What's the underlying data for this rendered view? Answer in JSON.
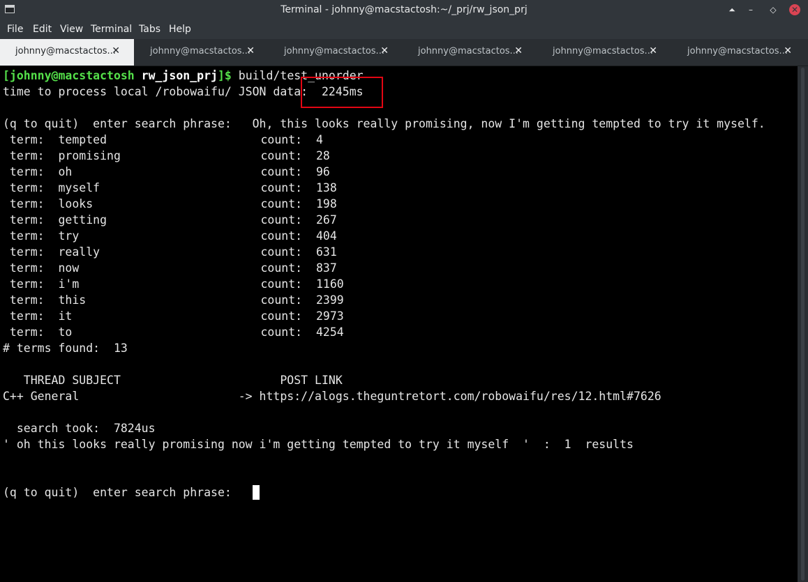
{
  "window": {
    "title": "Terminal - johnny@macstactosh:~/_prj/rw_json_prj"
  },
  "menu": [
    "File",
    "Edit",
    "View",
    "Terminal",
    "Tabs",
    "Help"
  ],
  "tabs": [
    {
      "label": "johnny@macstactos...",
      "close": "✕",
      "active": true
    },
    {
      "label": "johnny@macstactos...",
      "close": "✕",
      "active": false
    },
    {
      "label": "johnny@macstactos...",
      "close": "✕",
      "active": false
    },
    {
      "label": "johnny@macstactos...",
      "close": "✕",
      "active": false
    },
    {
      "label": "johnny@macstactos...",
      "close": "✕",
      "active": false
    },
    {
      "label": "johnny@macstactos...",
      "close": "✕",
      "active": false
    }
  ],
  "terminal": {
    "prompt": {
      "user": "[johnny@macstactosh",
      "dir": " rw_json_prj",
      "symbol": "]$",
      "command": " build/test_unorder"
    },
    "load_line": "time to process local /robowaifu/ JSON data:  2245ms",
    "search_line": "(q to quit)  enter search phrase:   Oh, this looks really promising, now I'm getting tempted to try it myself.",
    "terms": [
      {
        "term": "tempted",
        "count": "4"
      },
      {
        "term": "promising",
        "count": "28"
      },
      {
        "term": "oh",
        "count": "96"
      },
      {
        "term": "myself",
        "count": "138"
      },
      {
        "term": "looks",
        "count": "198"
      },
      {
        "term": "getting",
        "count": "267"
      },
      {
        "term": "try",
        "count": "404"
      },
      {
        "term": "really",
        "count": "631"
      },
      {
        "term": "now",
        "count": "837"
      },
      {
        "term": "i'm",
        "count": "1160"
      },
      {
        "term": "this",
        "count": "2399"
      },
      {
        "term": "it",
        "count": "2973"
      },
      {
        "term": "to",
        "count": "4254"
      }
    ],
    "terms_found": "# terms found:  13",
    "header_line": "   THREAD SUBJECT                       POST LINK",
    "result_line": "C++ General                       -> https://alogs.theguntretort.com/robowaifu/res/12.html#7626",
    "search_took": "  search took:  7824us",
    "summary_line": "' oh this looks really promising now i'm getting tempted to try it myself  '  :  1  results",
    "final_prompt": "(q to quit)  enter search phrase:   "
  }
}
